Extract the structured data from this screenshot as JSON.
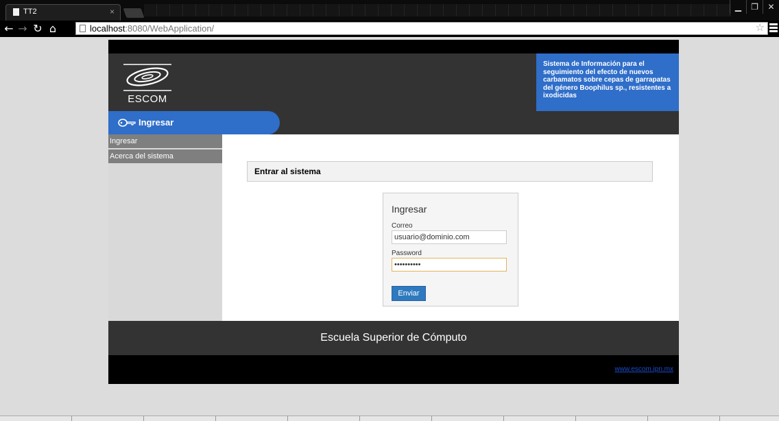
{
  "browser": {
    "tab_title": "TT2",
    "tab_close": "×",
    "url_host": "localhost",
    "url_path": ":8080/WebApplication/",
    "window_controls": [
      "▁",
      "❐",
      "✕"
    ]
  },
  "header": {
    "logo_text": "ESCOM",
    "system_info": "Sistema de Información para el seguimiento del efecto de nuevos carbamatos sobre cepas de garrapatas del género Boophilus sp., resistentes a ixodicidas"
  },
  "nav": {
    "active_label": "Ingresar"
  },
  "sidebar": {
    "items": [
      {
        "label": "Ingresar"
      },
      {
        "label": "Acerca del sistema"
      }
    ]
  },
  "main": {
    "section_title": "Entrar al sistema",
    "login": {
      "title": "Ingresar",
      "email_label": "Correo",
      "email_value": "usuario@dominio.com",
      "password_label": "Password",
      "password_value": "1234567890",
      "submit_label": "Enviar"
    }
  },
  "footer": {
    "school_name": "Escuela Superior de Cómputo",
    "site_link": "www.escom.ipn.mx"
  },
  "colors": {
    "accent_blue": "#2f6ec9",
    "header_dark": "#333333",
    "button_blue": "#2f7abf",
    "link_blue": "#1a4ccc"
  }
}
